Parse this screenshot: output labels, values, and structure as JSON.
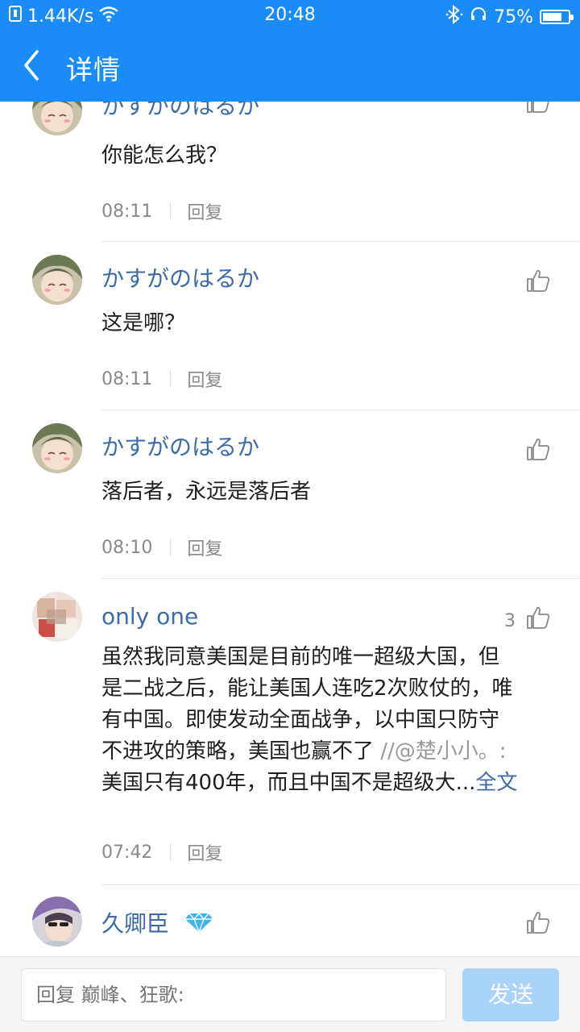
{
  "status": {
    "speed": "1.44K/s",
    "time": "20:48",
    "battery": "75%",
    "battery_level": 0.75
  },
  "nav": {
    "title": "详情"
  },
  "comments": [
    {
      "user": "かすがのはるか",
      "text": "你能怎么我？",
      "time": "08:11",
      "reply": "回复",
      "likes": ""
    },
    {
      "user": "かすがのはるか",
      "text": "这是哪？",
      "time": "08:11",
      "reply": "回复",
      "likes": ""
    },
    {
      "user": "かすがのはるか",
      "text": "落后者，永远是落后者",
      "time": "08:10",
      "reply": "回复",
      "likes": ""
    },
    {
      "user": "only one",
      "text_lines": [
        "虽然我同意美国是目前的唯一超级大国，但",
        "是二战之后，能让美国人连吃2次败仗的，唯",
        "有中国。即使发动全面战争，以中国只防守",
        "不进攻的策略，美国也赢不了 "
      ],
      "quote": "//@楚小小。:",
      "last_line": "美国只有400年，而且中国不是超级大...",
      "more": "全文",
      "time": "07:42",
      "reply": "回复",
      "likes": "3"
    },
    {
      "user": "久卿臣",
      "likes": ""
    }
  ],
  "replybar": {
    "placeholder": "回复 巅峰、狂歌:",
    "send": "发送"
  },
  "colors": {
    "header": "#1a8cf7",
    "username": "#3e6aa8",
    "send_button": "#a9d3f8"
  }
}
